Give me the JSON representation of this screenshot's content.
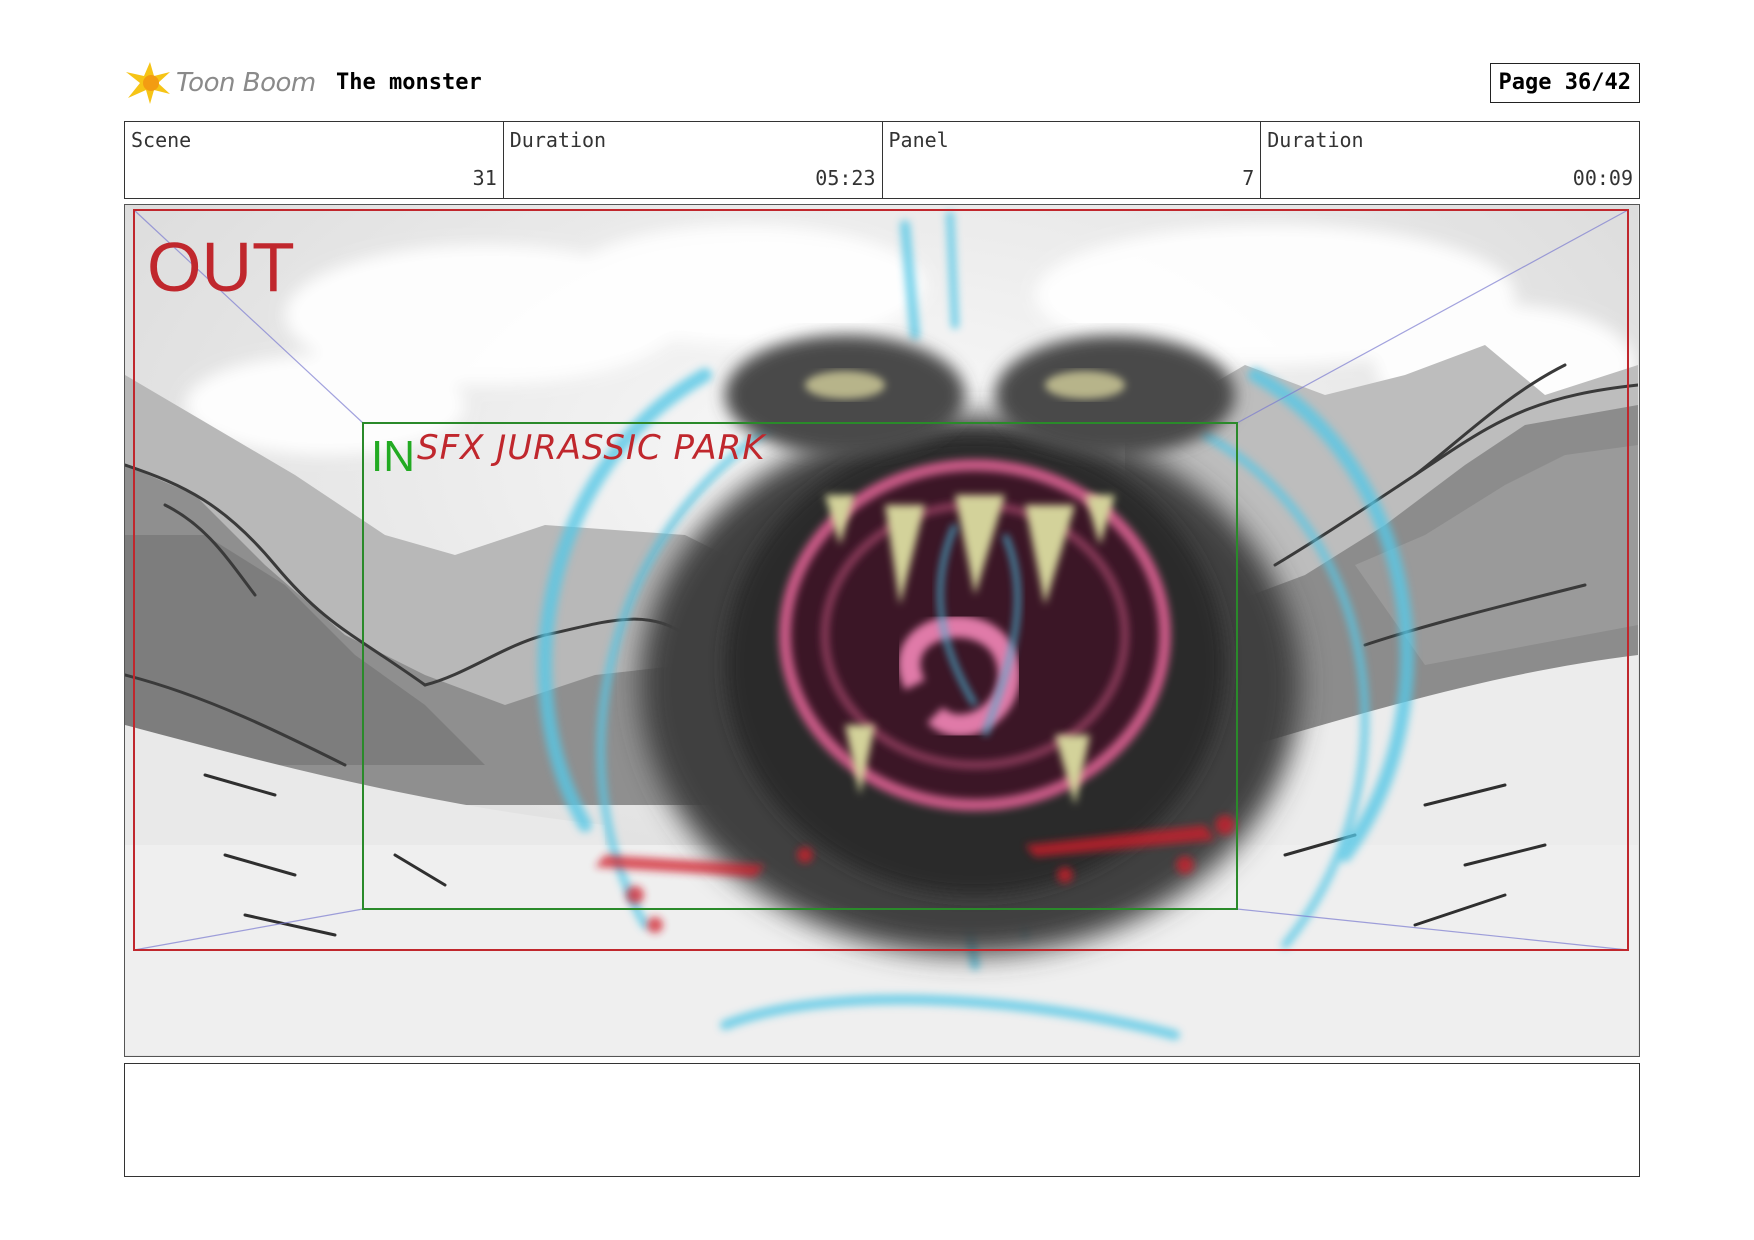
{
  "header": {
    "logo_text": "Toon Boom",
    "project_title": "The monster",
    "page_label": "Page 36/42"
  },
  "info": {
    "scene_label": "Scene",
    "scene_value": "31",
    "scene_duration_label": "Duration",
    "scene_duration_value": "05:23",
    "panel_label": "Panel",
    "panel_value": "7",
    "panel_duration_label": "Duration",
    "panel_duration_value": "00:09"
  },
  "panel": {
    "out_label": "OUT",
    "in_label": "IN",
    "sfx_note": "SFX JURASSIC PARK"
  },
  "colors": {
    "out_frame": "#c0272d",
    "in_frame": "#2a8a2a",
    "sfx_text": "#c0272d",
    "in_text": "#22aa22",
    "fx_blue": "#56c8e6"
  }
}
